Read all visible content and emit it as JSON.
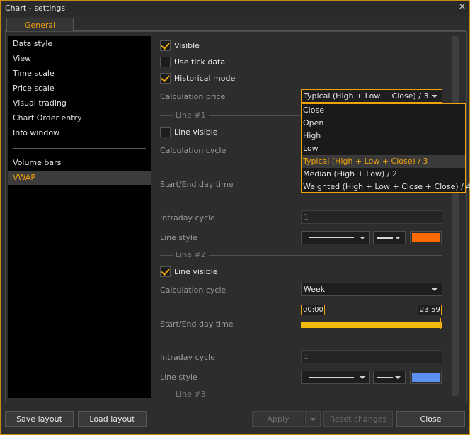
{
  "window": {
    "title": "Chart - settings",
    "close_glyph": "×"
  },
  "tabs": [
    {
      "label": "General",
      "active": true
    }
  ],
  "sidebar": {
    "items": [
      {
        "label": "Data style"
      },
      {
        "label": "View"
      },
      {
        "label": "Time scale"
      },
      {
        "label": "Price scale"
      },
      {
        "label": "Visual trading"
      },
      {
        "label": "Chart Order entry"
      },
      {
        "label": "Info window"
      }
    ],
    "items2": [
      {
        "label": "Volume bars"
      },
      {
        "label": "VWAP",
        "active": true
      }
    ]
  },
  "settings": {
    "visible": {
      "label": "Visible",
      "checked": true
    },
    "use_tick_data": {
      "label": "Use tick data",
      "checked": false
    },
    "historical_mode": {
      "label": "Historical mode",
      "checked": true
    },
    "calculation_price": {
      "label": "Calculation price",
      "value": "Typical (High + Low + Close) / 3"
    },
    "line1": {
      "header": "Line #1",
      "line_visible": {
        "label": "Line visible",
        "checked": false
      },
      "calculation_cycle_label": "Calculation cycle",
      "start_end_label": "Start/End day time",
      "intraday_cycle_label": "Intraday cycle",
      "intraday_cycle_value": "1",
      "line_style_label": "Line style",
      "color": "#ff6a00"
    },
    "line2": {
      "header": "Line #2",
      "line_visible": {
        "label": "Line visible",
        "checked": true
      },
      "calculation_cycle_label": "Calculation cycle",
      "calculation_cycle_value": "Week",
      "start_end_label": "Start/End day time",
      "start_time": "00:00",
      "end_time": "23:59",
      "intraday_cycle_label": "Intraday cycle",
      "intraday_cycle_value": "1",
      "line_style_label": "Line style",
      "color": "#5b8ff0"
    },
    "line3": {
      "header": "Line #3"
    }
  },
  "dropdown": {
    "options": [
      "Close",
      "Open",
      "High",
      "Low",
      "Typical (High + Low + Close) / 3",
      "Median (High + Low) / 2",
      "Weighted (High + Low + Close + Close) / 4"
    ],
    "selected_index": 4
  },
  "buttons": {
    "save_layout": "Save layout",
    "load_layout": "Load layout",
    "apply": "Apply",
    "reset_changes": "Reset changes",
    "close": "Close"
  },
  "colors": {
    "accent": "#f0a30a",
    "time_bar": "#f0b80a"
  }
}
